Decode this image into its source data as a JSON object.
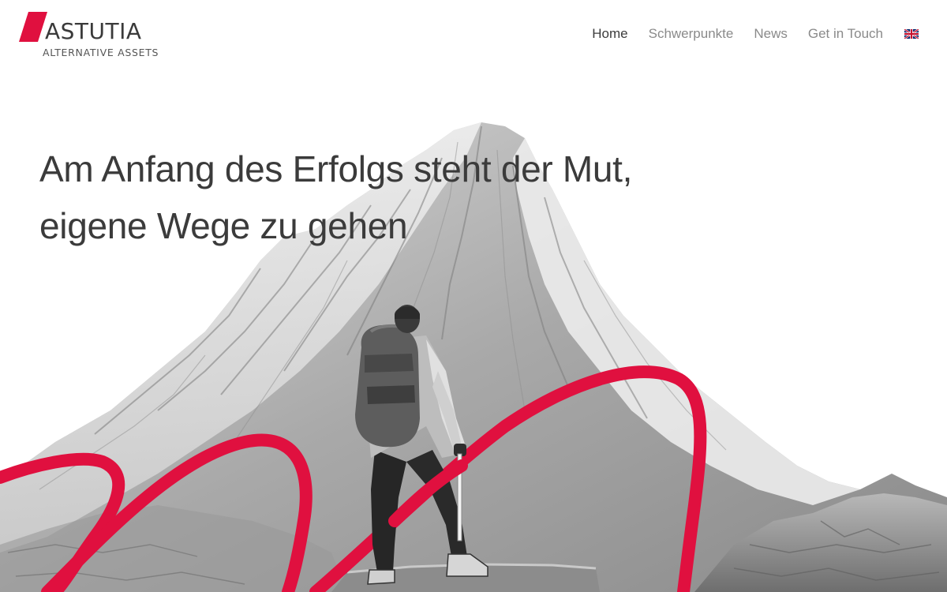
{
  "brand": {
    "name": "ASTUTIA",
    "tagline": "ALTERNATIVE ASSETS",
    "accent_color": "#e0103f",
    "text_color": "#3a3a3a"
  },
  "nav": {
    "items": [
      {
        "label": "Home",
        "active": true
      },
      {
        "label": "Schwerpunkte",
        "active": false
      },
      {
        "label": "News",
        "active": false
      },
      {
        "label": "Get in Touch",
        "active": false
      }
    ],
    "language_icon": "uk-flag-icon"
  },
  "hero": {
    "headline_line1": "Am Anfang des Erfolgs steht der Mut,",
    "headline_line2": "eigene Wege zu gehen",
    "image_subject": "hiker-on-mountain",
    "ribbon_color": "#e0103f"
  }
}
